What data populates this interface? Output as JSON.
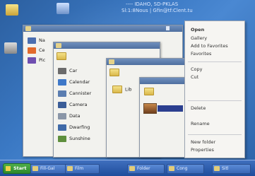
{
  "desktop": {
    "top_text_1": "---- IDAHO, SD-PKLAS",
    "top_text_2": "Sl:1:8Nous | Gfin@tf:Clent.tu"
  },
  "window1": {
    "title": ""
  },
  "window1_rows": [
    "Na",
    "Ce",
    "Pic"
  ],
  "window2": {
    "title": ""
  },
  "window2_rows": [
    "Car",
    "Calendar",
    "Cannister",
    "Camera",
    "Data",
    "Dwarfing",
    "Sunshine"
  ],
  "window3": {
    "title": ""
  },
  "window3_rows": [
    "Lib"
  ],
  "window4": {
    "title": ""
  },
  "context_menu": {
    "items": [
      "Open",
      "Gallery",
      "Add to Favorites",
      "Favorites",
      "Copy",
      "Cut",
      "Delete",
      "Rename",
      "New folder",
      "Properties"
    ]
  },
  "taskbar": {
    "start_label": "Start",
    "buttons": [
      "Fill-Gal",
      "Film",
      "Folder",
      "Cong",
      "Sitl"
    ]
  },
  "colors": {
    "desktop": "#3a78c3",
    "taskbar": "#2b5aa8",
    "selection": "#2b3f8f"
  }
}
